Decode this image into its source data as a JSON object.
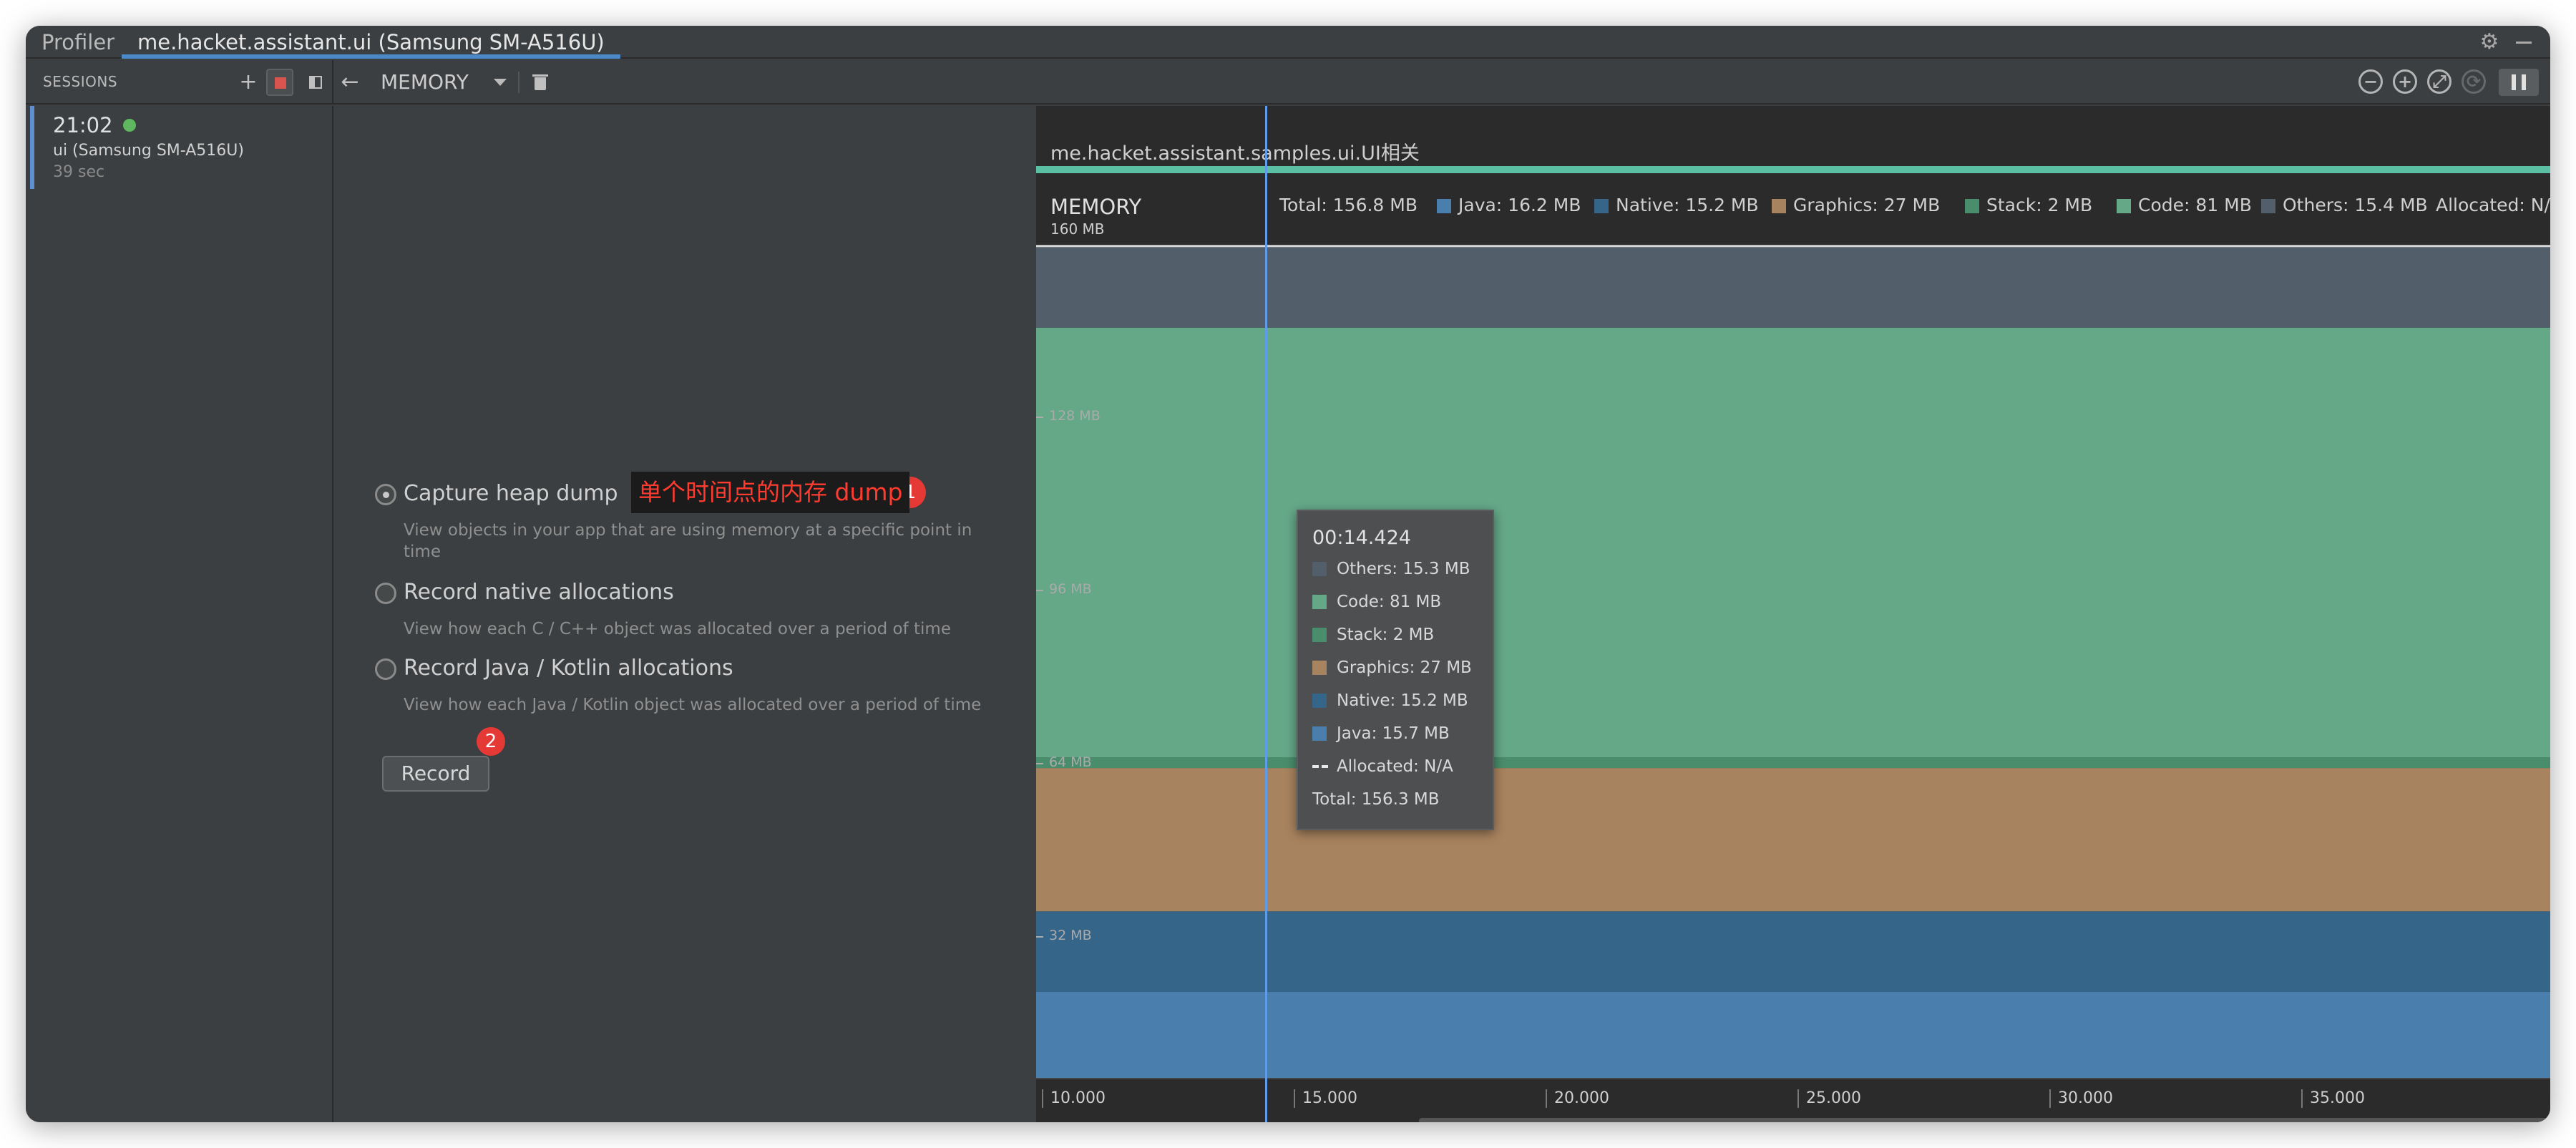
{
  "titlebar": {
    "tabs": [
      {
        "label": "Profiler"
      },
      {
        "label": "me.hacket.assistant.ui (Samsung SM-A516U)"
      }
    ]
  },
  "toolbar": {
    "sessions_label": "SESSIONS",
    "monitor": "MEMORY"
  },
  "session": {
    "time": "21:02",
    "device": "ui (Samsung SM-A516U)",
    "duration": "39 sec"
  },
  "options": [
    {
      "title": "Capture heap dump",
      "desc": "View objects in your app that are using memory at a specific point in time",
      "checked": true
    },
    {
      "title": "Record native allocations",
      "desc": "View how each C / C++ object was allocated over a period of time",
      "checked": false
    },
    {
      "title": "Record Java / Kotlin allocations",
      "desc": "View how each Java / Kotlin object was allocated over a period of time",
      "checked": false
    }
  ],
  "record_label": "Record",
  "annotations": {
    "badge1": "1",
    "badge2": "2",
    "label": "单个时间点的内存 dump"
  },
  "timeline": {
    "activity": "me.hacket.assistant.samples.ui.UI相关",
    "memory_label": "MEMORY",
    "axis_top": "160 MB",
    "legend": {
      "total": "Total: 156.8 MB",
      "java": "Java: 16.2 MB",
      "native": "Native: 15.2 MB",
      "graphics": "Graphics: 27 MB",
      "stack": "Stack: 2 MB",
      "code": "Code: 81 MB",
      "others": "Others: 15.4 MB",
      "allocated": "Allocated: N/A"
    },
    "y_ticks": [
      "128 MB",
      "96 MB",
      "64 MB",
      "32 MB"
    ],
    "x_ticks": [
      "10.000",
      "15.000",
      "20.000",
      "25.000",
      "30.000",
      "35.000"
    ]
  },
  "tooltip": {
    "time": "00:14.424",
    "others": "Others: 15.3 MB",
    "code": "Code: 81 MB",
    "stack": "Stack: 2 MB",
    "graphics": "Graphics: 27 MB",
    "native": "Native: 15.2 MB",
    "java": "Java: 15.7 MB",
    "allocated": "Allocated: N/A",
    "total": "Total: 156.3 MB"
  },
  "colors": {
    "java": "#4a7fad",
    "native": "#35668a",
    "graphics": "#a8835f",
    "stack": "#4a8d6c",
    "code": "#65a888",
    "others": "#525f6a",
    "cursor": "#5f9be8",
    "accent": "#4a88c7"
  },
  "chart_data": {
    "type": "area",
    "title": "MEMORY",
    "ylim": [
      0,
      160
    ],
    "yticks": [
      "128 MB",
      "96 MB",
      "64 MB",
      "32 MB"
    ],
    "xticks": [
      "10.000",
      "15.000",
      "20.000",
      "25.000",
      "30.000",
      "35.000"
    ],
    "series": [
      {
        "name": "Java",
        "values": [
          16.2
        ]
      },
      {
        "name": "Native",
        "values": [
          15.2
        ]
      },
      {
        "name": "Graphics",
        "values": [
          27
        ]
      },
      {
        "name": "Stack",
        "values": [
          2
        ]
      },
      {
        "name": "Code",
        "values": [
          81
        ]
      },
      {
        "name": "Others",
        "values": [
          15.4
        ]
      }
    ],
    "total": 156.8,
    "stacked": true
  }
}
